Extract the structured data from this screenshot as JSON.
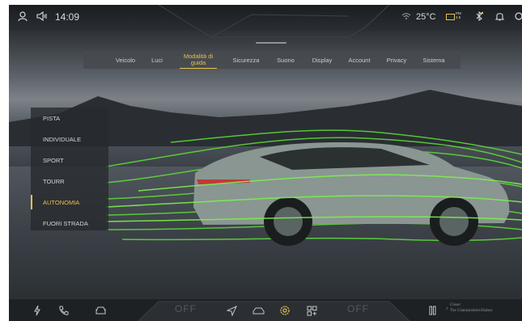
{
  "status_bar": {
    "time": "14:09",
    "temperature": "25°C",
    "air_quality": "PM 2.5"
  },
  "tabs": [
    {
      "label": "Veicolo"
    },
    {
      "label": "Luci"
    },
    {
      "label": "Modalità di guida",
      "active": true
    },
    {
      "label": "Sicurezza"
    },
    {
      "label": "Suono"
    },
    {
      "label": "Display"
    },
    {
      "label": "Account"
    },
    {
      "label": "Privacy"
    },
    {
      "label": "Sistema"
    }
  ],
  "drive_modes": [
    {
      "label": "PISTA"
    },
    {
      "label": "INDIVIDUALE"
    },
    {
      "label": "SPORT"
    },
    {
      "label": "TOURR"
    },
    {
      "label": "AUTONOMIA",
      "active": true
    },
    {
      "label": "FUORI STRADA"
    }
  ],
  "bottom_bar": {
    "left_climate": "OFF",
    "right_climate": "OFF",
    "media_line1": "Closer",
    "media_line2": "The Chainsmokers/Halsey"
  },
  "colors": {
    "accent": "#e8c14a",
    "airflow": "#5ee03a",
    "background": "#2c3034"
  }
}
